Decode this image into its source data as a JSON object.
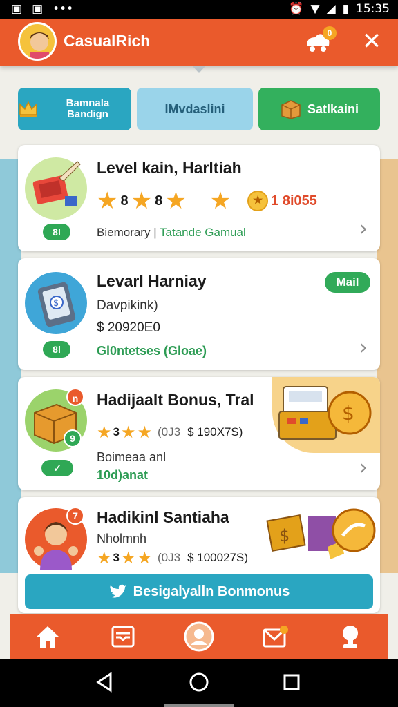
{
  "statusbar": {
    "time": "15:35"
  },
  "header": {
    "title": "CasualRich",
    "cart_badge": "0"
  },
  "tabs": [
    {
      "label": "Bamnala Bandign",
      "icon": "crown-icon"
    },
    {
      "label": "IMvdaslini",
      "icon": ""
    },
    {
      "label": "Satlkaini",
      "icon": "box-icon"
    }
  ],
  "cards": [
    {
      "title": "Level kain, Harltiah",
      "rating_a": "8",
      "rating_b": "8",
      "price": "1 8i055",
      "pill": "8l",
      "sub_dark": "Biemorary",
      "sub_green": "Tatande Gamual"
    },
    {
      "title": "Levarl Harniay",
      "badge": "Mail",
      "desc": "Davpikink)",
      "price": "$ 20920E0",
      "pill": "8l",
      "sub_green": "Gl0ntetses (Gloae)"
    },
    {
      "title": "Hadijaalt Bonus, Tral",
      "stars_text": "3",
      "extra": "(0J3",
      "price": "$ 190X7S)",
      "thumb_badge": "n",
      "thumb_badge2": "9",
      "desc": "Boimeaa anl",
      "green": "10d)anat"
    },
    {
      "title": "Hadikinl Santiaha",
      "sub": "Nholmnh",
      "stars_text": "3",
      "extra": "(0J3",
      "price": "$ 100027S)",
      "thumb_badge": "7"
    }
  ],
  "cta": {
    "label": "Besigalyalln Bonmonus"
  },
  "colors": {
    "primary": "#ea5a2c",
    "teal": "#2aa6c1",
    "green": "#33b05d",
    "star": "#f5a623"
  }
}
